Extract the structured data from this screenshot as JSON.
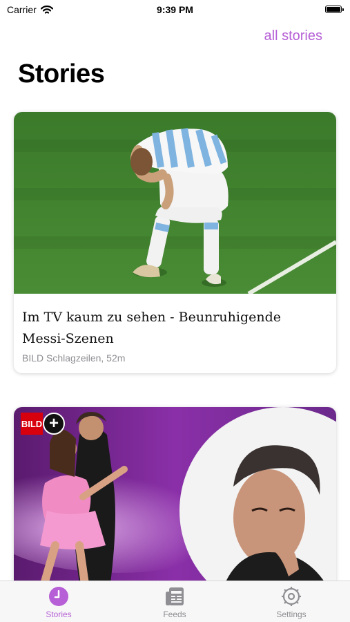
{
  "status_bar": {
    "carrier": "Carrier",
    "time": "9:39 PM"
  },
  "header": {
    "all_stories_link": "all stories",
    "title": "Stories"
  },
  "stories": [
    {
      "title": "Im TV kaum zu sehen - Beunruhigende Messi-Szenen",
      "meta": "BILD Schlagzeilen, 52m",
      "image_icon": "football-player-photo"
    },
    {
      "badge_logo": "BILD",
      "badge_plus": "+",
      "image_icon": "dance-couple-photo"
    }
  ],
  "tab_bar": {
    "tabs": [
      {
        "label": "Stories",
        "icon": "clock-icon",
        "active": true
      },
      {
        "label": "Feeds",
        "icon": "newspaper-icon",
        "active": false
      },
      {
        "label": "Settings",
        "icon": "gear-icon",
        "active": false
      }
    ]
  },
  "colors": {
    "accent": "#b65fd6",
    "inactive_tab": "#8e8e93",
    "bild_red": "#d9000d",
    "grass": "#3d7d2c"
  }
}
